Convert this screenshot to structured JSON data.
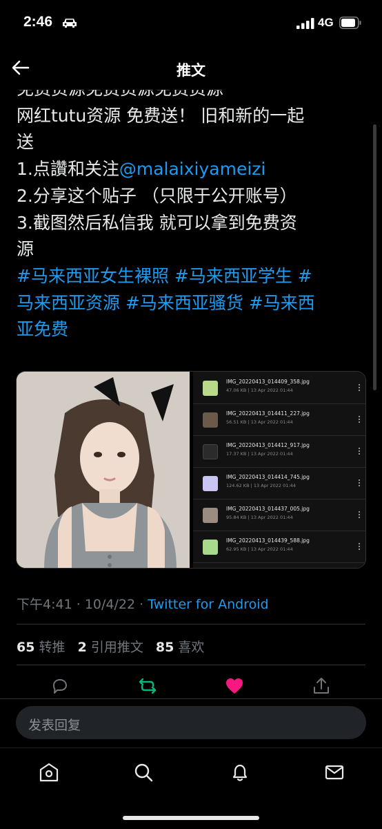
{
  "status_bar": {
    "time": "2:46",
    "network": "4G",
    "icons": [
      "car-icon",
      "signal-icon",
      "battery-icon"
    ]
  },
  "header": {
    "title": "推文",
    "back_icon": "arrow-left-icon"
  },
  "tweet": {
    "line_partial": "免费资源免费资源免费资源",
    "line_1": "网红tutu资源 免费送！ 旧和新的一起",
    "line_2": "送",
    "line_3_prefix": "1.点讚和关注",
    "line_3_mention": "@malaixiyameizi",
    "line_4": "2.分享这个贴子 （只限于公开账号）",
    "line_5": "3.截图然后私信我 就可以拿到免费资",
    "line_6": "源",
    "hashtags_line_1": "#马来西亚女生裸照 #马来西亚学生 #",
    "hashtags_line_2": "马来西亚资源 #马来西亚骚货 #马来西",
    "hashtags_line_3": "亚免费"
  },
  "media": {
    "files": [
      {
        "name": "IMG_20220413_014409_358.jpg",
        "meta": "47.06 KB  |  13 Apr 2022 01:44",
        "thumb": "#b8d98a"
      },
      {
        "name": "IMG_20220413_014411_227.jpg",
        "meta": "56.51 KB  |  13 Apr 2022 01:44",
        "thumb": "#6b5a4a"
      },
      {
        "name": "IMG_20220413_014412_917.jpg",
        "meta": "17.37 KB  |  13 Apr 2022 01:44",
        "thumb": "#2b2b2b"
      },
      {
        "name": "IMG_20220413_014414_745.jpg",
        "meta": "124.62 KB  |  13 Apr 2022 01:44",
        "thumb": "#c8c6f0"
      },
      {
        "name": "IMG_20220413_014437_005.jpg",
        "meta": "95.84 KB  |  13 Apr 2022 01:44",
        "thumb": "#9a8c80"
      },
      {
        "name": "IMG_20220413_014439_588.jpg",
        "meta": "62.95 KB  |  13 Apr 2022 01:44",
        "thumb": "#a9d98c"
      }
    ]
  },
  "meta": {
    "time": "下午4:41",
    "date": "10/4/22",
    "separator": "·",
    "source": "Twitter for Android"
  },
  "stats": {
    "retweets_count": "65",
    "retweets_label": "转推",
    "quotes_count": "2",
    "quotes_label": "引用推文",
    "likes_count": "85",
    "likes_label": "喜欢"
  },
  "actions": {
    "colors": {
      "retweet": "#00ba7c",
      "like": "#f91880",
      "icon": "#71767b"
    }
  },
  "reply": {
    "placeholder": "发表回复"
  },
  "colors": {
    "accent": "#1d9bf0",
    "background": "#000000"
  }
}
